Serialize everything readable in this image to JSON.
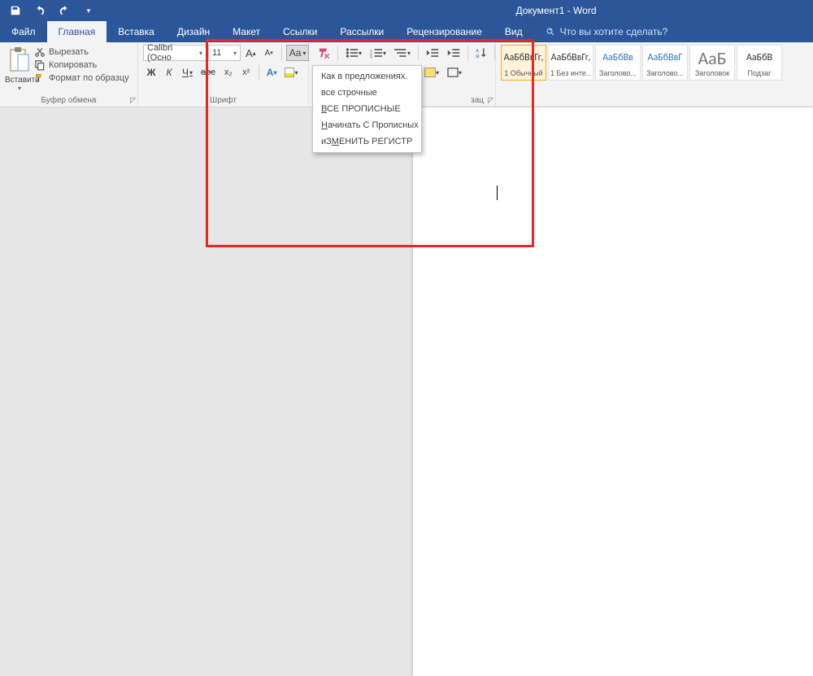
{
  "app_title": "Документ1 - Word",
  "tabs": {
    "file": "Файл",
    "home": "Главная",
    "insert": "Вставка",
    "design": "Дизайн",
    "layout": "Макет",
    "references": "Ссылки",
    "mailings": "Рассылки",
    "review": "Рецензирование",
    "view": "Вид",
    "tell_me": "Что вы хотите сделать?"
  },
  "clipboard": {
    "paste": "Вставить",
    "cut": "Вырезать",
    "copy": "Копировать",
    "format_painter": "Формат по образцу",
    "group_label": "Буфер обмена"
  },
  "font": {
    "name": "Calibri (Осно",
    "size": "11",
    "grow": "A˄",
    "shrink": "A˅",
    "change_case_label": "Aa",
    "clear": "",
    "bold_label": "Ж",
    "italic_label": "К",
    "underline_label": "Ч",
    "strike_label": "abc",
    "subscript": "x₂",
    "superscript": "x²",
    "text_effects": "A",
    "highlight": "",
    "font_color": "",
    "group_label": "Шрифт"
  },
  "paragraph": {
    "group_label_fragment": "зац"
  },
  "styles": {
    "items": [
      {
        "sample": "АаБбВвГг,",
        "name": "1 Обычный",
        "cls": "med",
        "selected": true
      },
      {
        "sample": "АаБбВвГг,",
        "name": "1 Без инте...",
        "cls": "med"
      },
      {
        "sample": "АаБбВв",
        "name": "Заголово...",
        "cls": "blue med"
      },
      {
        "sample": "АаБбВвГ",
        "name": "Заголово...",
        "cls": "blue med"
      },
      {
        "sample": "АаБ",
        "name": "Заголовок",
        "cls": "big"
      },
      {
        "sample": "АаБбВ",
        "name": "Подзаг",
        "cls": "med"
      }
    ]
  },
  "case_menu": {
    "items": [
      "Как в предложениях.",
      "все строчные",
      "ВСЕ ПРОПИСНЫЕ",
      "Начинать С Прописных",
      "иЗМЕНИТЬ РЕГИСТР"
    ],
    "underline_index": [
      null,
      null,
      0,
      0,
      2
    ]
  }
}
